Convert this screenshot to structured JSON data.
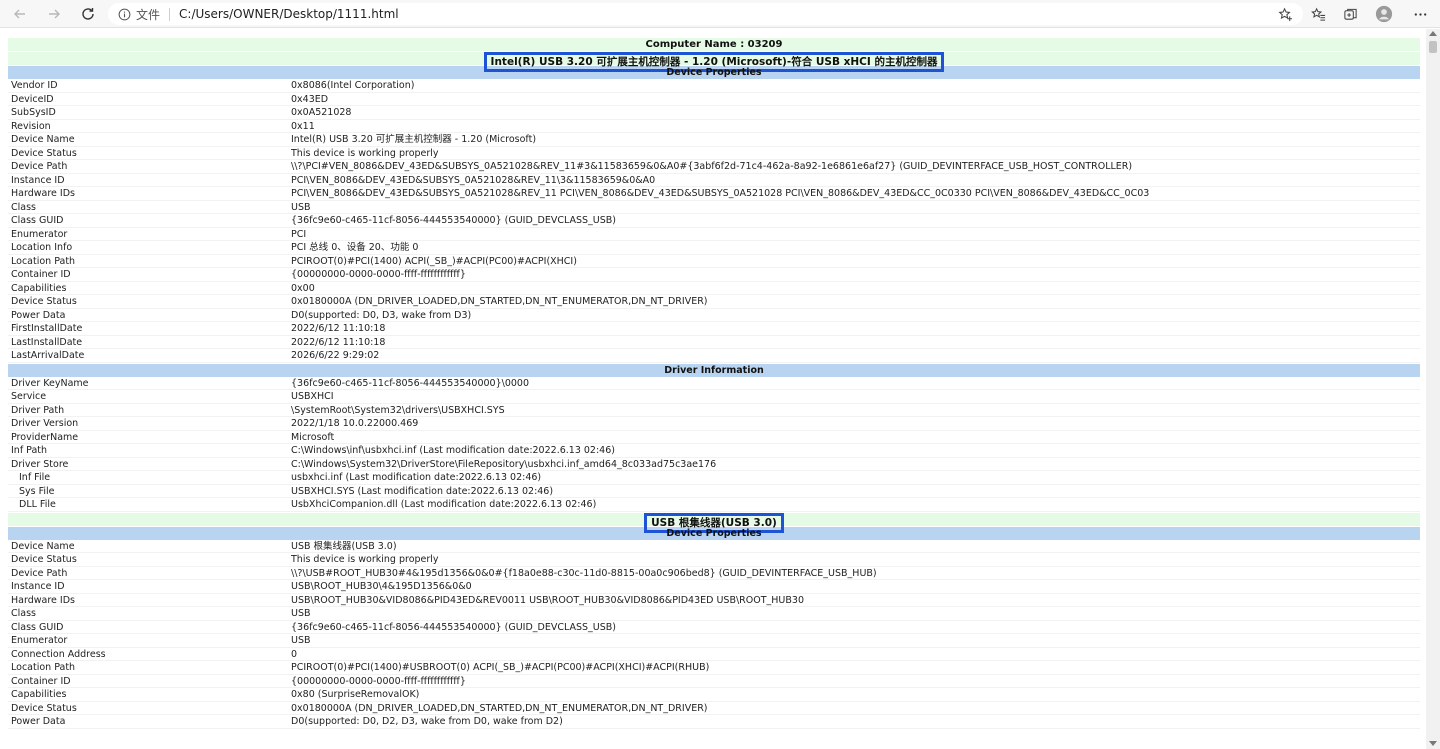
{
  "browser": {
    "scheme_label": "文件",
    "url": "C:/Users/OWNER/Desktop/1111.html",
    "icons": [
      "back-icon",
      "forward-icon",
      "refresh-icon",
      "info-icon",
      "favorite-add-icon",
      "favorites-icon",
      "collections-icon",
      "profile-icon",
      "more-icon"
    ]
  },
  "report": {
    "computer_name": "Computer Name : 03209",
    "device1": {
      "title": "Intel(R) USB 3.20 可扩展主机控制器 - 1.20 (Microsoft)-符合 USB xHCI 的主机控制器",
      "props_header": "Device Properties",
      "properties": [
        {
          "key": "Vendor ID",
          "value": "0x8086(Intel Corporation)"
        },
        {
          "key": "DeviceID",
          "value": "0x43ED"
        },
        {
          "key": "SubSysID",
          "value": "0x0A521028"
        },
        {
          "key": "Revision",
          "value": "0x11"
        },
        {
          "key": "Device Name",
          "value": "Intel(R) USB 3.20 可扩展主机控制器 - 1.20 (Microsoft)"
        },
        {
          "key": "Device Status",
          "value": "This device is working properly"
        },
        {
          "key": "Device Path",
          "value": "\\\\?\\PCI#VEN_8086&DEV_43ED&SUBSYS_0A521028&REV_11#3&11583659&0&A0#{3abf6f2d-71c4-462a-8a92-1e6861e6af27} (GUID_DEVINTERFACE_USB_HOST_CONTROLLER)"
        },
        {
          "key": "Instance ID",
          "value": "PCI\\VEN_8086&DEV_43ED&SUBSYS_0A521028&REV_11\\3&11583659&0&A0"
        },
        {
          "key": "Hardware IDs",
          "value": "PCI\\VEN_8086&DEV_43ED&SUBSYS_0A521028&REV_11 PCI\\VEN_8086&DEV_43ED&SUBSYS_0A521028 PCI\\VEN_8086&DEV_43ED&CC_0C0330 PCI\\VEN_8086&DEV_43ED&CC_0C03"
        },
        {
          "key": "Class",
          "value": "USB"
        },
        {
          "key": "Class GUID",
          "value": "{36fc9e60-c465-11cf-8056-444553540000} (GUID_DEVCLASS_USB)"
        },
        {
          "key": "Enumerator",
          "value": "PCI"
        },
        {
          "key": "Location Info",
          "value": "PCI 总线 0、设备 20、功能 0"
        },
        {
          "key": "Location Path",
          "value": "PCIROOT(0)#PCI(1400) ACPI(_SB_)#ACPI(PC00)#ACPI(XHCI)"
        },
        {
          "key": "Container ID",
          "value": "{00000000-0000-0000-ffff-ffffffffffff}"
        },
        {
          "key": "Capabilities",
          "value": "0x00"
        },
        {
          "key": "Device Status",
          "value": "0x0180000A (DN_DRIVER_LOADED,DN_STARTED,DN_NT_ENUMERATOR,DN_NT_DRIVER)"
        },
        {
          "key": "Power Data",
          "value": "D0(supported: D0, D3, wake from D3)"
        },
        {
          "key": "FirstInstallDate",
          "value": "2022/6/12 11:10:18"
        },
        {
          "key": "LastInstallDate",
          "value": "2022/6/12 11:10:18"
        },
        {
          "key": "LastArrivalDate",
          "value": "2026/6/22 9:29:02"
        }
      ],
      "driver_header": "Driver Information",
      "driver": [
        {
          "key": "Driver KeyName",
          "value": "{36fc9e60-c465-11cf-8056-444553540000}\\0000"
        },
        {
          "key": "Service",
          "value": "USBXHCI"
        },
        {
          "key": "Driver Path",
          "value": "\\SystemRoot\\System32\\drivers\\USBXHCI.SYS"
        },
        {
          "key": "Driver Version",
          "value": "2022/1/18 10.0.22000.469"
        },
        {
          "key": "ProviderName",
          "value": "Microsoft"
        },
        {
          "key": "Inf Path",
          "value": "C:\\Windows\\inf\\usbxhci.inf (Last modification date:2022.6.13 02:46)"
        },
        {
          "key": "Driver Store",
          "value": "C:\\Windows\\System32\\DriverStore\\FileRepository\\usbxhci.inf_amd64_8c033ad75c3ae176"
        },
        {
          "key": "Inf File",
          "value": "usbxhci.inf (Last modification date:2022.6.13 02:46)",
          "sub": true
        },
        {
          "key": "Sys File",
          "value": "USBXHCI.SYS (Last modification date:2022.6.13 02:46)",
          "sub": true
        },
        {
          "key": "DLL File",
          "value": "UsbXhciCompanion.dll (Last modification date:2022.6.13 02:46)",
          "sub": true
        }
      ]
    },
    "device2": {
      "title": "USB 根集线器(USB 3.0)",
      "props_header": "Device Properties",
      "properties": [
        {
          "key": "Device Name",
          "value": "USB 根集线器(USB 3.0)"
        },
        {
          "key": "Device Status",
          "value": "This device is working properly"
        },
        {
          "key": "Device Path",
          "value": "\\\\?\\USB#ROOT_HUB30#4&195d1356&0&0#{f18a0e88-c30c-11d0-8815-00a0c906bed8} (GUID_DEVINTERFACE_USB_HUB)"
        },
        {
          "key": "Instance ID",
          "value": "USB\\ROOT_HUB30\\4&195D1356&0&0"
        },
        {
          "key": "Hardware IDs",
          "value": "USB\\ROOT_HUB30&VID8086&PID43ED&REV0011 USB\\ROOT_HUB30&VID8086&PID43ED USB\\ROOT_HUB30"
        },
        {
          "key": "Class",
          "value": "USB"
        },
        {
          "key": "Class GUID",
          "value": "{36fc9e60-c465-11cf-8056-444553540000} (GUID_DEVCLASS_USB)"
        },
        {
          "key": "Enumerator",
          "value": "USB"
        },
        {
          "key": "Connection Address",
          "value": "0"
        },
        {
          "key": "Location Path",
          "value": "PCIROOT(0)#PCI(1400)#USBROOT(0) ACPI(_SB_)#ACPI(PC00)#ACPI(XHCI)#ACPI(RHUB)"
        },
        {
          "key": "Container ID",
          "value": "{00000000-0000-0000-ffff-ffffffffffff}"
        },
        {
          "key": "Capabilities",
          "value": "0x80 (SurpriseRemovalOK)"
        },
        {
          "key": "Device Status",
          "value": "0x0180000A (DN_DRIVER_LOADED,DN_STARTED,DN_NT_ENUMERATOR,DN_NT_DRIVER)"
        },
        {
          "key": "Power Data",
          "value": "D0(supported: D0, D2, D3, wake from D0, wake from D2)"
        }
      ]
    }
  },
  "colors": {
    "section_green": "#e6fbe6",
    "section_blue": "#b9d4f0",
    "highlight_border": "#1f53d6"
  }
}
